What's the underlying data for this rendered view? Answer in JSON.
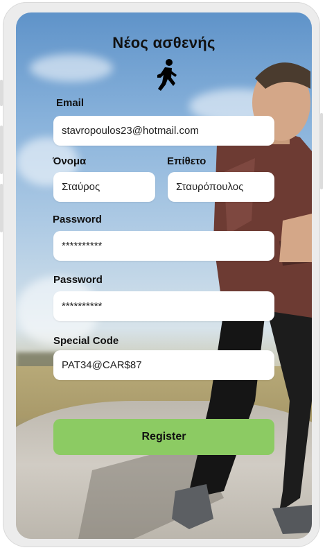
{
  "screen": {
    "title": "Νέος ασθενής"
  },
  "form": {
    "email": {
      "label": "Email",
      "value": "stavropoulos23@hotmail.com"
    },
    "first_name": {
      "label": "Όνομα",
      "value": "Σταύρος"
    },
    "last_name": {
      "label": "Επίθετο",
      "value": "Σταυρόπουλος"
    },
    "password": {
      "label": "Password",
      "value": "**********"
    },
    "password_confirm": {
      "label": "Password",
      "value": "**********"
    },
    "special_code": {
      "label": "Special Code",
      "value": "PAT34@CAR$87"
    },
    "register_label": "Register"
  },
  "icons": {
    "header_icon": "walking-person-icon"
  },
  "colors": {
    "register_button": "#8ccb63",
    "input_bg": "#ffffff",
    "text": "#111111"
  }
}
